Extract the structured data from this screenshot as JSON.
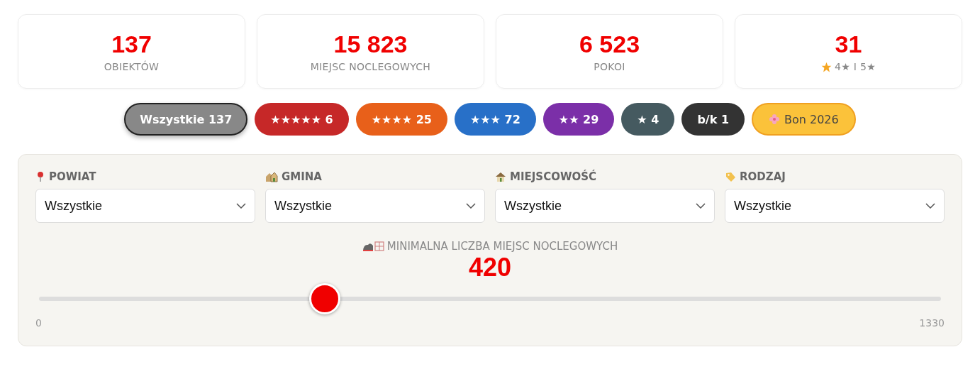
{
  "stats": [
    {
      "value": "137",
      "label": "OBIEKTÓW"
    },
    {
      "value": "15 823",
      "label": "MIEJSC NOCLEGOWYCH"
    },
    {
      "value": "6 523",
      "label": "POKOI"
    },
    {
      "value": "31",
      "label": "4★ I 5★",
      "kind": "star"
    }
  ],
  "chips": [
    {
      "label": "Wszystkie 137",
      "color": "#888888",
      "selected": true
    },
    {
      "label": "★★★★★ 6",
      "color": "#c62828",
      "selected": false
    },
    {
      "label": "★★★★ 25",
      "color": "#e8601a",
      "selected": false
    },
    {
      "label": "★★★ 72",
      "color": "#2870c8",
      "selected": false
    },
    {
      "label": "★★ 29",
      "color": "#7b2fa8",
      "selected": false
    },
    {
      "label": "★ 4",
      "color": "#455a60",
      "selected": false
    },
    {
      "label": "b/k 1",
      "color": "#333333",
      "selected": false
    },
    {
      "label": "Bon 2026",
      "color": "#fbc23a",
      "selected": false,
      "kind": "bon"
    }
  ],
  "filters": [
    {
      "label": "POWIAT",
      "kind": "pin",
      "value": "Wszystkie"
    },
    {
      "label": "GMINA",
      "kind": "houses",
      "value": "Wszystkie"
    },
    {
      "label": "MIEJSCOWOŚĆ",
      "kind": "house",
      "value": "Wszystkie"
    },
    {
      "label": "RODZAJ",
      "kind": "tag",
      "value": "Wszystkie"
    }
  ],
  "slider": {
    "label": "MINIMALNA LICZBA MIEJSC NOCLEGOWYCH",
    "reading": "420",
    "level": 0.316,
    "min": "0",
    "max": "1330"
  }
}
